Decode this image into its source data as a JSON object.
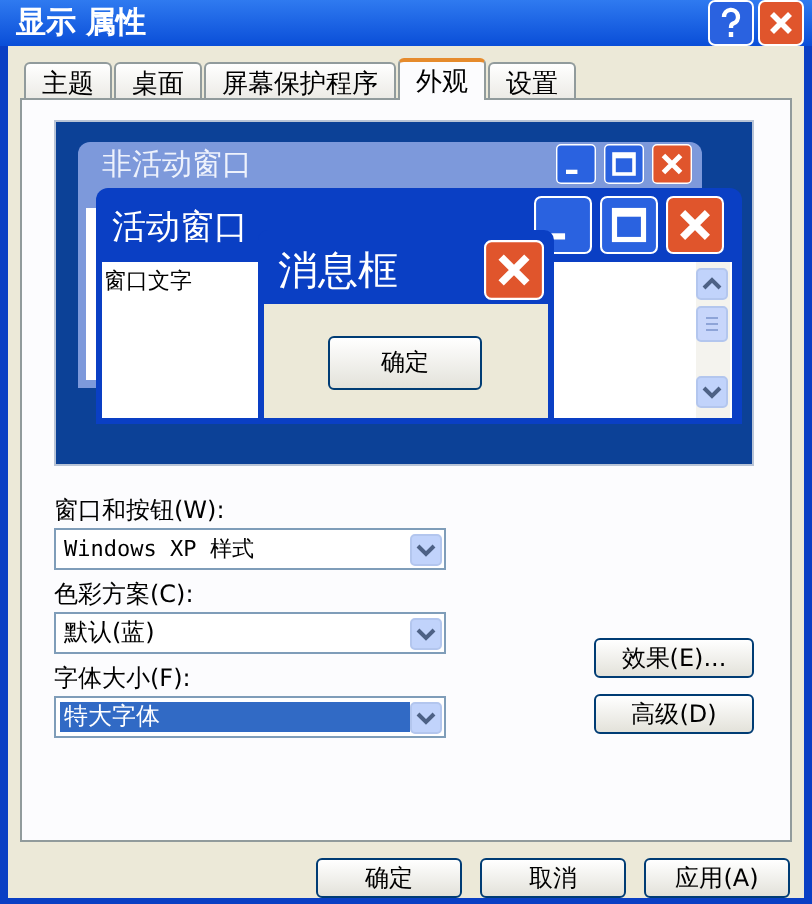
{
  "window": {
    "title": "显示 属性"
  },
  "tabs": [
    {
      "label": "主题",
      "selected": false
    },
    {
      "label": "桌面",
      "selected": false
    },
    {
      "label": "屏幕保护程序",
      "selected": false
    },
    {
      "label": "外观",
      "selected": true
    },
    {
      "label": "设置",
      "selected": false
    }
  ],
  "preview": {
    "inactive_window": {
      "title": "非活动窗口"
    },
    "active_window": {
      "title": "活动窗口",
      "text": "窗口文字"
    },
    "message_box": {
      "title": "消息框",
      "button": "确定"
    }
  },
  "fields": [
    {
      "label": "窗口和按钮(W):",
      "value": "Windows XP 样式",
      "highlighted": false
    },
    {
      "label": "色彩方案(C):",
      "value": "默认(蓝)",
      "highlighted": false
    },
    {
      "label": "字体大小(F):",
      "value": "特大字体",
      "highlighted": true
    }
  ],
  "side_buttons": [
    "效果(E)...",
    "高级(D)"
  ],
  "buttons": [
    "确定",
    "取消",
    "应用(A)"
  ]
}
